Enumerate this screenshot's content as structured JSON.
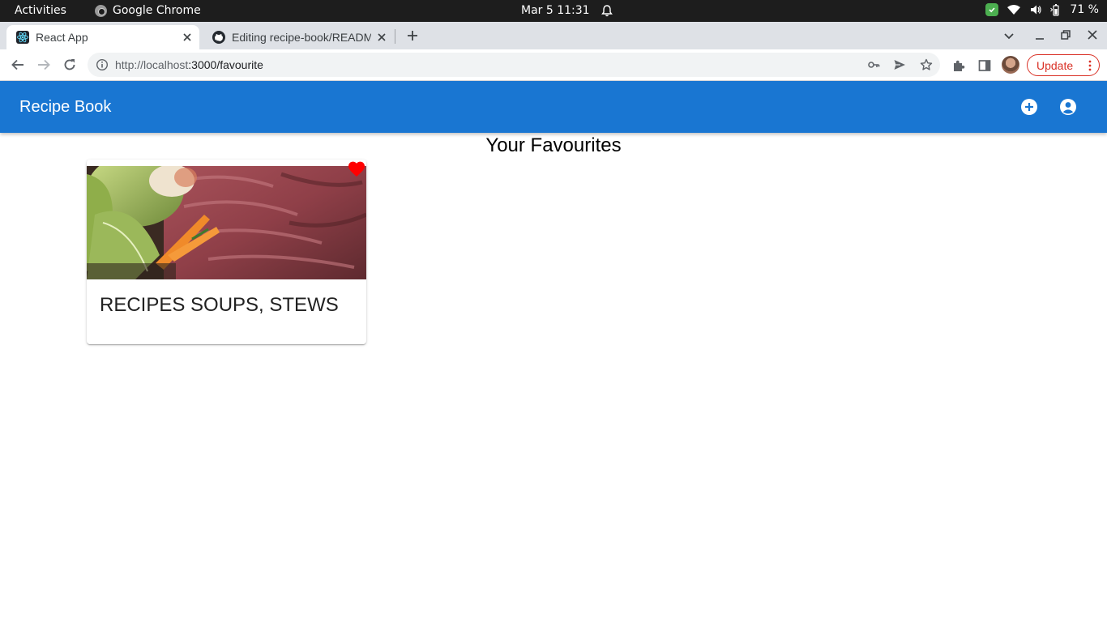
{
  "system_bar": {
    "activities": "Activities",
    "app_name": "Google Chrome",
    "clock": "Mar 5  11:31",
    "battery": "71 %"
  },
  "browser": {
    "tabs": [
      {
        "title": "React App",
        "active": true,
        "favicon": "react-icon"
      },
      {
        "title": "Editing recipe-book/README",
        "active": false,
        "favicon": "github-icon"
      }
    ],
    "url_host": "http://localhost",
    "url_path": ":3000/favourite",
    "update_label": "Update",
    "accent_update": "#d93025"
  },
  "app": {
    "title": "Recipe Book",
    "bar_color": "#1976d2",
    "icons": [
      "add-circle-icon",
      "account-circle-icon"
    ]
  },
  "page": {
    "heading": "Your Favourites"
  },
  "favourites": [
    {
      "title": "RECIPES SOUPS, STEWS",
      "favourited": true,
      "heart_color": "#ff0000"
    }
  ]
}
